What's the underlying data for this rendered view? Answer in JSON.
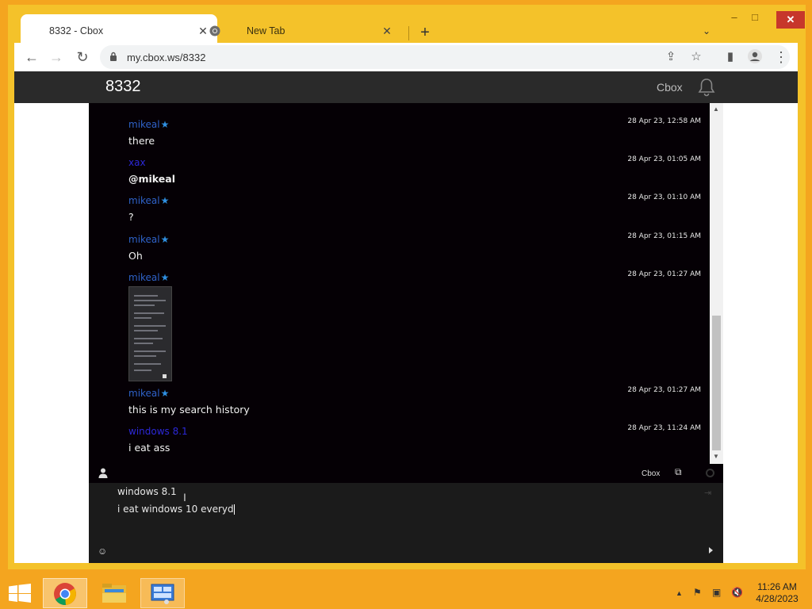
{
  "browser": {
    "tabs": [
      {
        "title": "8332 - Cbox",
        "active": true
      },
      {
        "title": "New Tab",
        "active": false
      }
    ],
    "new_tab_icon": "+",
    "url": "my.cbox.ws/8332",
    "window_controls": {
      "minimize": "–",
      "maximize": "□",
      "close": "✕"
    }
  },
  "site": {
    "title": "8332",
    "brand": "Cbox"
  },
  "messages": [
    {
      "user": "mikeal",
      "verified": true,
      "guest": false,
      "time": "28 Apr 23, 12:58 AM",
      "text": "there"
    },
    {
      "user": "xax",
      "verified": false,
      "guest": true,
      "time": "28 Apr 23, 01:05 AM",
      "text": "@mikeal",
      "bold": true
    },
    {
      "user": "mikeal",
      "verified": true,
      "guest": false,
      "time": "28 Apr 23, 01:10 AM",
      "text": "?"
    },
    {
      "user": "mikeal",
      "verified": true,
      "guest": false,
      "time": "28 Apr 23, 01:15 AM",
      "text": "Oh"
    },
    {
      "user": "mikeal",
      "verified": true,
      "guest": false,
      "time": "28 Apr 23, 01:27 AM",
      "text": "",
      "image": true
    },
    {
      "user": "mikeal",
      "verified": true,
      "guest": false,
      "time": "28 Apr 23, 01:27 AM",
      "text": "this is my search history"
    },
    {
      "user": "windows 8.1",
      "verified": false,
      "guest": true,
      "time": "28 Apr 23, 11:24 AM",
      "text": "i eat ass"
    }
  ],
  "chat_bar": {
    "brand": "Cbox"
  },
  "compose": {
    "name": "windows 8.1",
    "input_value": "i eat windows 10 everyd"
  },
  "taskbar": {
    "apps": [
      "chrome",
      "file-explorer",
      "control-panel"
    ],
    "time": "11:26 AM",
    "date": "4/28/2023"
  },
  "colors": {
    "os_accent": "#f4a51f",
    "chat_bg": "#050005",
    "username": "#2f62c9",
    "guest_username": "#2c28d8"
  }
}
